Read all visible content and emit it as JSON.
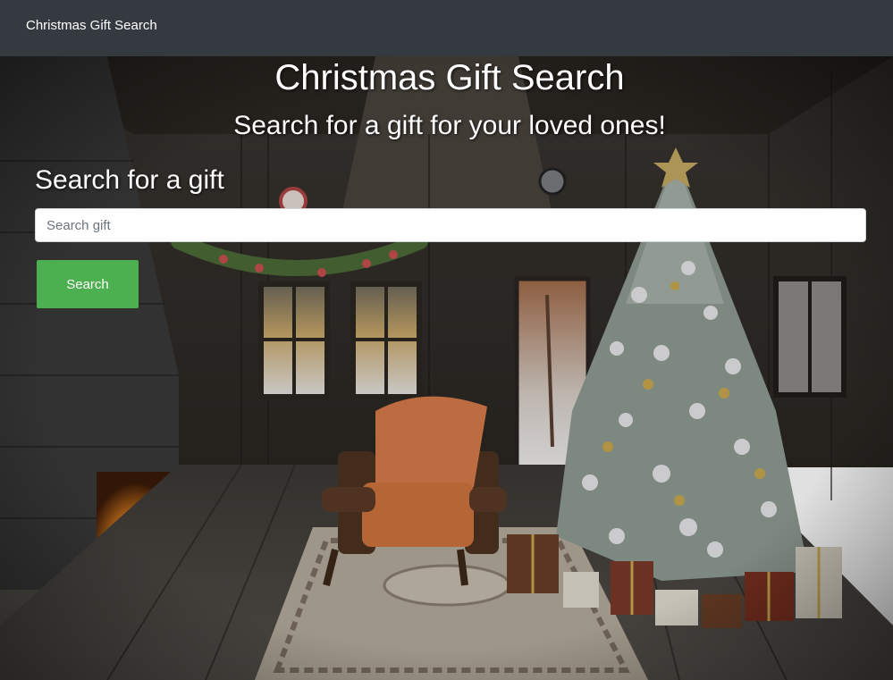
{
  "navbar": {
    "brand": "Christmas Gift Search"
  },
  "hero": {
    "title": "Christmas Gift Search",
    "subtitle": "Search for a gift for your loved ones!"
  },
  "search_form": {
    "heading": "Search for a gift",
    "input_placeholder": "Search gift",
    "input_value": "",
    "button_label": "Search"
  },
  "colors": {
    "navbar_bg": "#343a40",
    "button_bg": "#4caf50",
    "text": "#ffffff"
  }
}
